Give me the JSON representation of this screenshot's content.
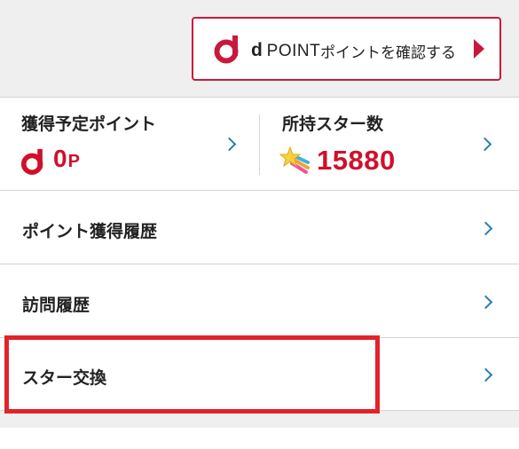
{
  "header": {
    "dpoint_button": {
      "logo_letter": "d",
      "brand_word": "POINT",
      "cta_label": "ポイントを確認する",
      "accent_color": "#c8193c"
    }
  },
  "summary": {
    "pending_points": {
      "title": "獲得予定ポイント",
      "value": "0",
      "unit": "P",
      "icon": "dpoint-logo-icon"
    },
    "stars": {
      "title": "所持スター数",
      "value": "15880",
      "icon": "shooting-star-icon"
    },
    "value_color": "#d0102a"
  },
  "menu": {
    "items": [
      {
        "label": "ポイント獲得履歴"
      },
      {
        "label": "訪問履歴"
      },
      {
        "label": "スター交換"
      }
    ]
  },
  "annotation": {
    "highlight_color": "#e2232a"
  }
}
